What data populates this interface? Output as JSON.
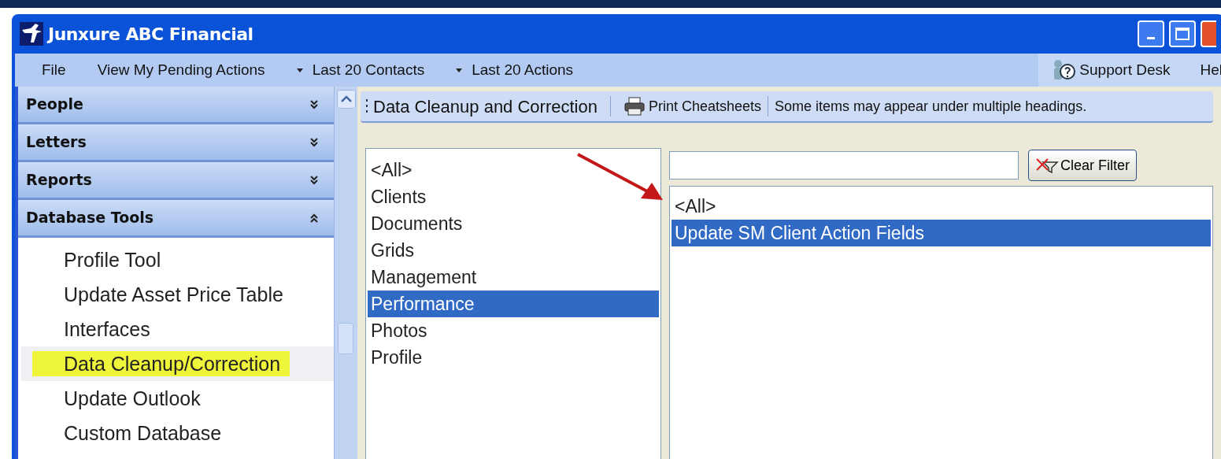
{
  "window": {
    "title": "Junxure ABC Financial"
  },
  "menu_bar": {
    "items": [
      {
        "label": "File",
        "kind": "plain"
      },
      {
        "label": "View My Pending Actions",
        "kind": "plain"
      },
      {
        "label": "Last 20 Contacts",
        "kind": "dropdown"
      },
      {
        "label": "Last 20 Actions",
        "kind": "dropdown"
      }
    ],
    "right_items": [
      {
        "label": "Support Desk",
        "kind": "support"
      },
      {
        "label": "Hel",
        "kind": "plain"
      }
    ]
  },
  "sidebar": {
    "sections": [
      {
        "label": "People",
        "expanded": false
      },
      {
        "label": "Letters",
        "expanded": false
      },
      {
        "label": "Reports",
        "expanded": false
      },
      {
        "label": "Database Tools",
        "expanded": true,
        "items": [
          {
            "label": "Profile Tool",
            "selected": false
          },
          {
            "label": "Update Asset Price Table",
            "selected": false
          },
          {
            "label": "Interfaces",
            "selected": false
          },
          {
            "label": "Data Cleanup/Correction",
            "selected": true
          },
          {
            "label": "Update Outlook",
            "selected": false
          },
          {
            "label": "Custom Database",
            "selected": false
          }
        ]
      }
    ]
  },
  "toolbar": {
    "title": "Data Cleanup and Correction",
    "print_button": "Print Cheatsheets",
    "note": "Some items may appear under multiple headings."
  },
  "categories": [
    {
      "label": "<All>",
      "selected": false
    },
    {
      "label": "Clients",
      "selected": false
    },
    {
      "label": "Documents",
      "selected": false
    },
    {
      "label": "Grids",
      "selected": false
    },
    {
      "label": "Management",
      "selected": false
    },
    {
      "label": "Performance",
      "selected": true
    },
    {
      "label": "Photos",
      "selected": false
    },
    {
      "label": "Profile",
      "selected": false
    }
  ],
  "clear_filter_button": "Clear Filter",
  "tools": [
    {
      "label": "<All>",
      "selected": false
    },
    {
      "label": "Update SM Client Action Fields",
      "selected": true
    }
  ]
}
